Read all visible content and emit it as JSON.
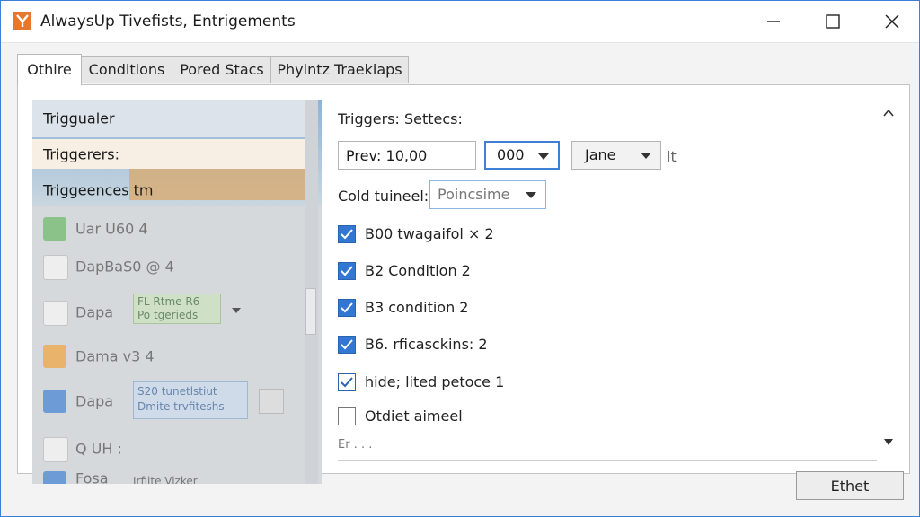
{
  "window": {
    "title": "AlwaysUp Tivefists, Entrigements",
    "accent_color": "#3b7fd6",
    "app_icon": "alwaysup-logo-icon"
  },
  "tabs": [
    {
      "label": "Othire",
      "active": true
    },
    {
      "label": "Conditions",
      "active": false
    },
    {
      "label": "Pored Stacs",
      "active": false
    },
    {
      "label": "Phyintz Traekiaps",
      "active": false
    }
  ],
  "left_list": {
    "items": [
      {
        "label": "Triggualer"
      },
      {
        "label": "Triggerers:"
      },
      {
        "label": "Triggeences tm"
      },
      {
        "label": "Uar U60 4",
        "icon": "clock-icon"
      },
      {
        "label": "DapBaS0 @ 4",
        "icon": "checkbox-icon"
      },
      {
        "label": "Dapa",
        "icon": "checkbox-icon",
        "field_text_1": "FL Rtme R6",
        "field_text_2": "Po tgerieds"
      },
      {
        "label": "Dama v3 4",
        "icon": "star-icon"
      },
      {
        "label": "Dapa",
        "icon": "checked-icon",
        "field_text_1": "S20 tunetlstiut",
        "field_text_2": "Dmite trvfiteshs"
      },
      {
        "label": "Q   UH :",
        "icon": "checkbox-icon"
      },
      {
        "label": "Fosa",
        "icon": "checked-icon",
        "field_text_1": "Irfiite Vizker"
      }
    ]
  },
  "right": {
    "triggers_label": "Triggers: Settecs:",
    "prev_input_value": "Prev: 10,00",
    "count_dropdown": {
      "selected": "000"
    },
    "name_dropdown": {
      "selected": "Jane"
    },
    "suffix_text": "it",
    "cold_label": "Cold tuineel:",
    "cold_dropdown": {
      "selected": "Poincsime"
    },
    "checkboxes": [
      {
        "label": "B00 twagaifol × 2",
        "checked": true
      },
      {
        "label": "B2 Condition 2",
        "checked": true
      },
      {
        "label": "B3 condition 2",
        "checked": true
      },
      {
        "label": "B6. rficasckins: 2",
        "checked": true
      },
      {
        "label": "hide; lited petoce 1",
        "checked": true
      },
      {
        "label": "Otdiet aimeel",
        "checked": false
      }
    ],
    "ellipsis_text": "Er . . ."
  },
  "footer": {
    "ok_label": "Ethet"
  }
}
